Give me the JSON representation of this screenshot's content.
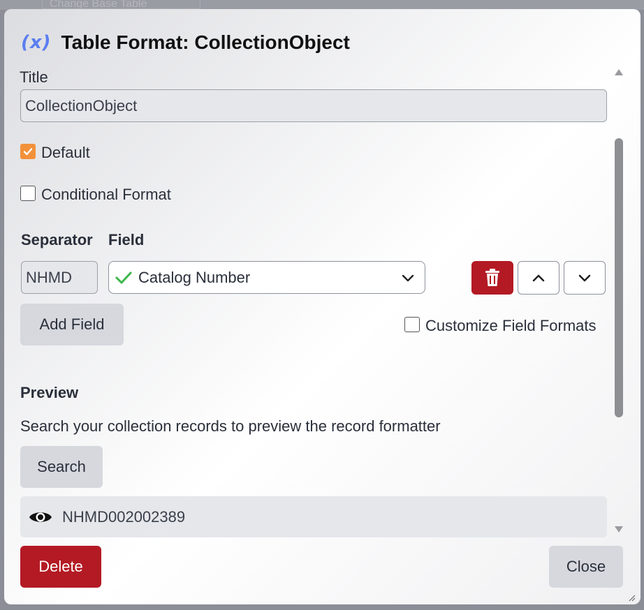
{
  "backdrop": {
    "tab_label": "Change Base Table"
  },
  "dialog": {
    "title": "Table Format: CollectionObject",
    "icon": "variable-icon",
    "icon_text": "(x)"
  },
  "form": {
    "title_label": "Title",
    "title_value": "CollectionObject",
    "default_label": "Default",
    "default_checked": true,
    "conditional_label": "Conditional Format",
    "conditional_checked": false,
    "separator_header": "Separator",
    "field_header": "Field",
    "separator_value": "NHMD",
    "field_value": "Catalog Number",
    "add_field_label": "Add Field",
    "customize_label": "Customize Field Formats",
    "customize_checked": false
  },
  "preview": {
    "heading": "Preview",
    "description": "Search your collection records to preview the record formatter",
    "search_label": "Search",
    "result_value": "NHMD002002389"
  },
  "footer": {
    "delete_label": "Delete",
    "close_label": "Close"
  },
  "colors": {
    "accent": "#f3913a",
    "danger": "#b31a24",
    "valid_check": "#3cb64a",
    "header_icon": "#5b7ef0"
  }
}
